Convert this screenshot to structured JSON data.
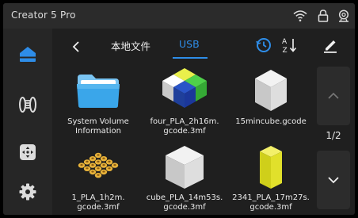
{
  "statusbar": {
    "device_name": "Creator 5 Pro",
    "icons": [
      "wifi-icon",
      "lock-icon",
      "camera-icon"
    ]
  },
  "sidebar": {
    "items": [
      {
        "name": "home",
        "icon": "home-icon",
        "active": true
      },
      {
        "name": "filament",
        "icon": "filament-spool-icon",
        "active": false
      },
      {
        "name": "control",
        "icon": "move-control-icon",
        "active": false
      },
      {
        "name": "settings",
        "icon": "gear-icon",
        "active": false
      }
    ]
  },
  "header": {
    "tabs": [
      {
        "label": "本地文件",
        "active": false
      },
      {
        "label": "USB",
        "active": true
      }
    ],
    "icons": [
      "history-icon",
      "sort-icon",
      "edit-icon"
    ]
  },
  "files": [
    {
      "name": "System Volume\nInformation",
      "kind": "folder"
    },
    {
      "name": "four_PLA_2h16m.\ngcode.3mf",
      "kind": "multicolor-cube"
    },
    {
      "name": "15mincube.gcode",
      "kind": "white-cube"
    },
    {
      "name": "1_PLA_1h2m.\ngcode.3mf",
      "kind": "bead-grid"
    },
    {
      "name": "cube_PLA_14m53s.\ngcode.3mf",
      "kind": "white-cube"
    },
    {
      "name": "2341_PLA_17m27s.\ngcode.3mf",
      "kind": "yellow-cuboid"
    }
  ],
  "pager": {
    "page_indicator": "1/2",
    "current_page": 1,
    "total_pages": 2
  },
  "colors": {
    "accent": "#2e8de8",
    "background": "#1f1f1f",
    "panel": "#2c2c2c"
  }
}
